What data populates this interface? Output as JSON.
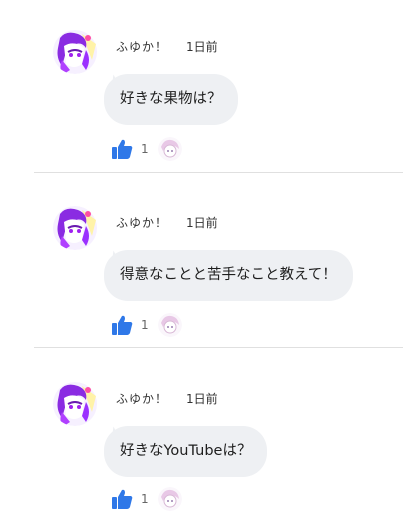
{
  "colors": {
    "like": "#2f78e8",
    "bubble": "#eef0f3",
    "divider": "#e0e0e0"
  },
  "posts": [
    {
      "author": "ふゆか！",
      "time": "1日前",
      "message": "好きな果物は？",
      "like_count": "1",
      "icon": "like-thumbs-up-icon"
    },
    {
      "author": "ふゆか！",
      "time": "1日前",
      "message": "得意なことと苦手なこと教えて！",
      "like_count": "1",
      "icon": "like-thumbs-up-icon"
    },
    {
      "author": "ふゆか！",
      "time": "1日前",
      "message": "好きなYouTubeは？",
      "like_count": "1",
      "icon": "like-thumbs-up-icon"
    }
  ]
}
